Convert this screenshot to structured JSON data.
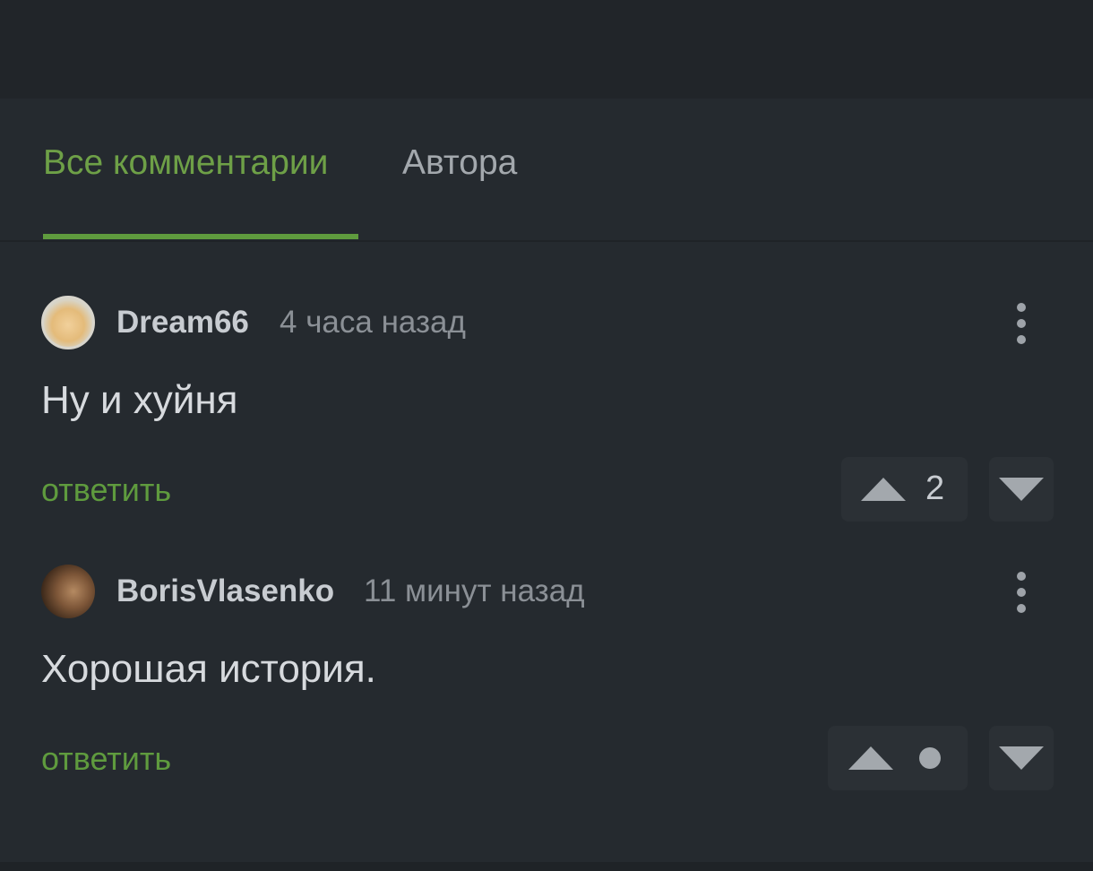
{
  "tabs": {
    "all_label": "Все комментарии",
    "author_label": "Автора",
    "active": "all"
  },
  "comments": [
    {
      "author": "Dream66",
      "time": "4 часа назад",
      "text": "Ну и хуйня",
      "reply_label": "ответить",
      "score": "2"
    },
    {
      "author": "BorisVlasenko",
      "time": "11 минут назад",
      "text": "Хорошая история.",
      "reply_label": "ответить",
      "score": "",
      "score_hidden_indicator": "dot"
    }
  ],
  "colors": {
    "background": "#252a2f",
    "accent_green": "#5f9b3e",
    "active_tab": "#6ea047",
    "inactive_tab": "#a3a8ad"
  },
  "icons": {
    "more": "more-vertical-icon",
    "upvote": "upvote-arrow-icon",
    "downvote": "downvote-arrow-icon"
  }
}
